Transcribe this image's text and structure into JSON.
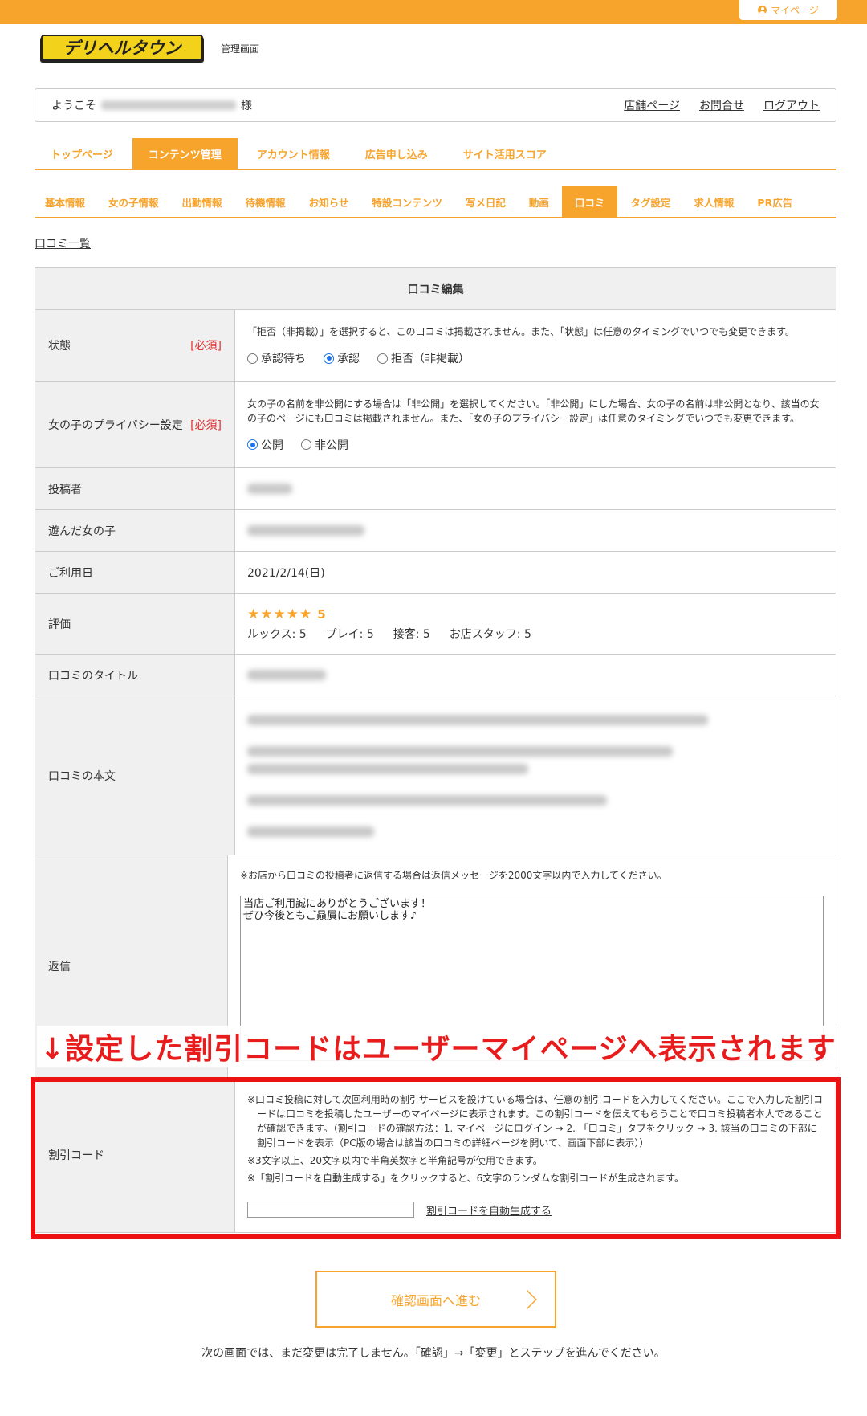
{
  "topbar": {
    "mypage_label": "マイページ"
  },
  "header": {
    "logo_text": "デリヘルタウン",
    "admin_label": "管理画面"
  },
  "welcome": {
    "prefix": "ようこそ",
    "suffix": "様",
    "links": [
      "店舗ページ",
      "お問合せ",
      "ログアウト"
    ]
  },
  "main_nav": {
    "tabs": [
      {
        "label": "トップページ"
      },
      {
        "label": "コンテンツ管理"
      },
      {
        "label": "アカウント情報"
      },
      {
        "label": "広告申し込み"
      },
      {
        "label": "サイト活用スコア"
      }
    ]
  },
  "sub_nav": {
    "tabs": [
      {
        "label": "基本情報"
      },
      {
        "label": "女の子情報"
      },
      {
        "label": "出勤情報"
      },
      {
        "label": "待機情報"
      },
      {
        "label": "お知らせ"
      },
      {
        "label": "特設コンテンツ"
      },
      {
        "label": "写メ日記"
      },
      {
        "label": "動画"
      },
      {
        "label": "口コミ"
      },
      {
        "label": "タグ設定"
      },
      {
        "label": "求人情報"
      },
      {
        "label": "PR広告"
      }
    ]
  },
  "back_link": "口コミ一覧",
  "form": {
    "title": "口コミ編集",
    "required_mark": "[必須]",
    "status": {
      "label": "状態",
      "note": "「拒否（非掲載）」を選択すると、この口コミは掲載されません。また、「状態」は任意のタイミングでいつでも変更できます。",
      "options": [
        "承認待ち",
        "承認",
        "拒否（非掲載）"
      ],
      "selected": "承認"
    },
    "privacy": {
      "label": "女の子のプライバシー設定",
      "note": "女の子の名前を非公開にする場合は「非公開」を選択してください。「非公開」にした場合、女の子の名前は非公開となり、該当の女の子のページにも口コミは掲載されません。また、「女の子のプライバシー設定」は任意のタイミングでいつでも変更できます。",
      "options": [
        "公開",
        "非公開"
      ],
      "selected": "公開"
    },
    "poster": {
      "label": "投稿者"
    },
    "girl": {
      "label": "遊んだ女の子"
    },
    "date": {
      "label": "ご利用日",
      "value": "2021/2/14(日)"
    },
    "rating": {
      "label": "評価",
      "stars": "★★★★★",
      "score": "5",
      "breakdown": [
        "ルックス: 5",
        "プレイ: 5",
        "接客: 5",
        "お店スタッフ: 5"
      ]
    },
    "review_title": {
      "label": "口コミのタイトル"
    },
    "review_body": {
      "label": "口コミの本文"
    },
    "reply": {
      "label": "返信",
      "note": "※お店から口コミの投稿者に返信する場合は返信メッセージを2000文字以内で入力してください。",
      "value": "当店ご利用誠にありがとうございます！\nぜひ今後ともご贔屓にお願いします♪"
    },
    "discount": {
      "label": "割引コード",
      "note1": "※口コミ投稿に対して次回利用時の割引サービスを設けている場合は、任意の割引コードを入力してください。ここで入力した割引コードは口コミを投稿したユーザーのマイページに表示されます。この割引コードを伝えてもらうことで口コミ投稿者本人であることが確認できます。（割引コードの確認方法：1. マイページにログイン → 2. 「口コミ」タブをクリック → 3. 該当の口コミの下部に割引コードを表示（PC版の場合は該当の口コミの詳細ページを開いて、画面下部に表示））",
      "note2": "※3文字以上、20文字以内で半角英数字と半角記号が使用できます。",
      "note3": "※「割引コードを自動生成する」をクリックすると、6文字のランダムな割引コードが生成されます。",
      "value": "",
      "generate_label": "割引コードを自動生成する"
    }
  },
  "annotation": "↓設定した割引コードはユーザーマイページへ表示されます",
  "submit_label": "確認画面へ進む",
  "bottom_note": "次の画面では、まだ変更は完了しません。「確認」→「変更」とステップを進んでください。",
  "colors": {
    "accent": "#f7a42d",
    "required": "#e53030",
    "annotation": "#e81c1c"
  }
}
